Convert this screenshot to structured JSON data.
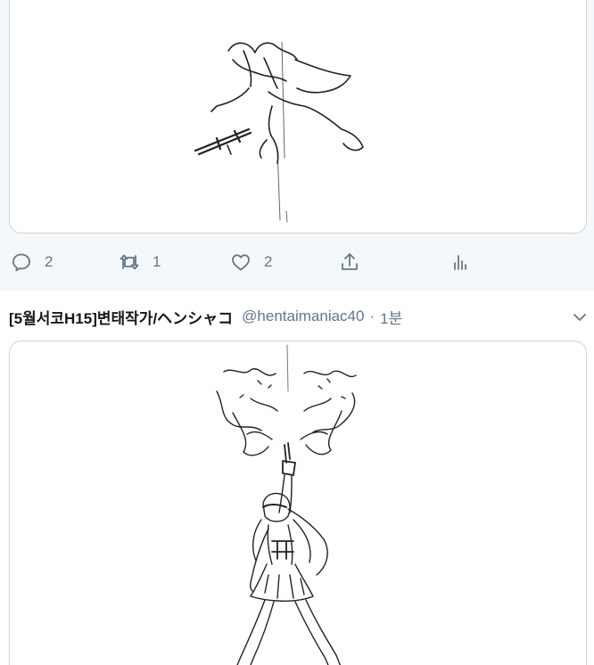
{
  "tweet_prev": {
    "media_alt": "pencil sketch of an airborne figure with a rifle",
    "actions": {
      "reply_count": "2",
      "retweet_count": "1",
      "like_count": "2"
    },
    "icons": [
      "reply-icon",
      "retweet-icon",
      "like-icon",
      "share-icon",
      "analytics-icon"
    ]
  },
  "tweet": {
    "display_name": "[5월서코H15]변태작가/ヘンシャコ",
    "handle": "@hentaimaniac40",
    "separator": "·",
    "time": "1분",
    "media_alt": "pencil sketch of a girl firing a pistol upward",
    "icons": [
      "chevron-down-icon"
    ]
  },
  "colors": {
    "muted": "#657786",
    "border": "#ccd6dd",
    "timeline_bg": "#f5f8fa",
    "text": "#14171a"
  }
}
